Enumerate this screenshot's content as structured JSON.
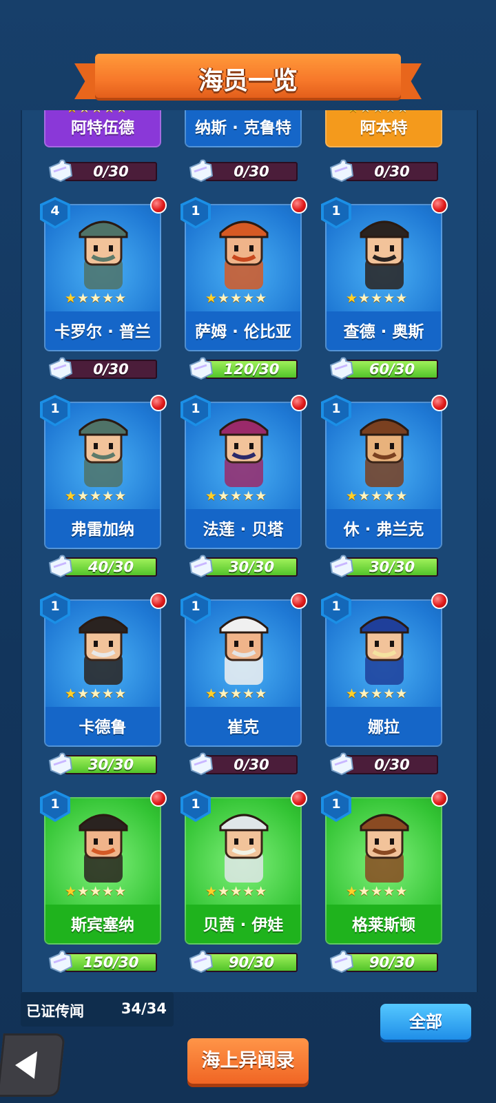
{
  "header": {
    "title": "海员一览"
  },
  "cards": [
    {
      "name": "阿特伍德",
      "color": "purple",
      "progress": "0/30",
      "fill": 0,
      "partial": true
    },
    {
      "name": "纳斯 · 克鲁特",
      "color": "blue",
      "progress": "0/30",
      "fill": 0,
      "partial": true
    },
    {
      "name": "阿本特",
      "color": "orange",
      "progress": "0/30",
      "fill": 0,
      "partial": true
    },
    {
      "name": "卡罗尔 · 普兰",
      "level": "4",
      "color": "blue",
      "stars": 1,
      "progress": "0/30",
      "fill": 0
    },
    {
      "name": "萨姆 · 伦比亚",
      "level": "1",
      "color": "blue",
      "stars": 1,
      "progress": "120/30",
      "fill": 1
    },
    {
      "name": "查德 · 奥斯",
      "level": "1",
      "color": "blue",
      "stars": 1,
      "progress": "60/30",
      "fill": 1
    },
    {
      "name": "弗雷加纳",
      "level": "1",
      "color": "blue",
      "stars": 1,
      "progress": "40/30",
      "fill": 1
    },
    {
      "name": "法莲 · 贝塔",
      "level": "1",
      "color": "blue",
      "stars": 1,
      "progress": "30/30",
      "fill": 1
    },
    {
      "name": "休 · 弗兰克",
      "level": "1",
      "color": "blue",
      "stars": 1,
      "progress": "30/30",
      "fill": 1
    },
    {
      "name": "卡德鲁",
      "level": "1",
      "color": "blue",
      "stars": 1,
      "progress": "30/30",
      "fill": 1
    },
    {
      "name": "崔克",
      "level": "1",
      "color": "blue",
      "stars": 1,
      "progress": "0/30",
      "fill": 0
    },
    {
      "name": "娜拉",
      "level": "1",
      "color": "blue",
      "stars": 1,
      "progress": "0/30",
      "fill": 0
    },
    {
      "name": "斯宾塞纳",
      "level": "1",
      "color": "green",
      "stars": 1,
      "progress": "150/30",
      "fill": 1
    },
    {
      "name": "贝茜 · 伊娃",
      "level": "1",
      "color": "green",
      "stars": 1,
      "progress": "90/30",
      "fill": 1
    },
    {
      "name": "格莱斯顿",
      "level": "1",
      "color": "green",
      "stars": 1,
      "progress": "90/30",
      "fill": 1
    }
  ],
  "footer": {
    "legend_label": "已证传闻",
    "legend_value": "34/34",
    "all_button": "全部",
    "story_button": "海上异闻录"
  },
  "colors": {
    "accent": "#f7782a",
    "blue_card": "#1e78d4",
    "green_card": "#33c434"
  }
}
